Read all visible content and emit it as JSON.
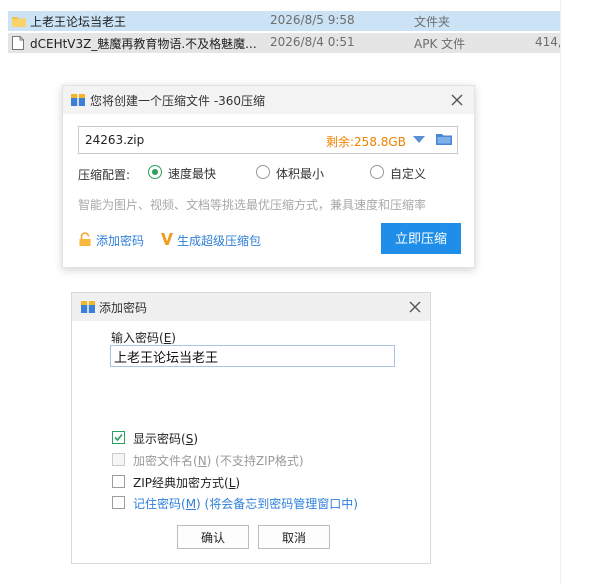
{
  "explorer": {
    "files": [
      {
        "name": "上老王论坛当老王",
        "date": "2026/8/5 9:58",
        "type": "文件夹",
        "size": "",
        "icon": "folder-icon"
      },
      {
        "name": "dCEHtV3Z_魅魔再教育物语.不及格魅魔...",
        "date": "2026/8/4 0:51",
        "type": "APK 文件",
        "size": "414,",
        "icon": "file-icon"
      }
    ]
  },
  "compress_dialog": {
    "title": "您将创建一个压缩文件 -360压缩",
    "filename": "24263.zip",
    "remaining": "剩余:258.8GB",
    "config_label": "压缩配置:",
    "options": [
      "速度最快",
      "体积最小",
      "自定义"
    ],
    "selected_option": "速度最快",
    "hint": "智能为图片、视频、文档等挑选最优压缩方式，兼具速度和压缩率",
    "add_password_label": "添加密码",
    "super_package_label": "生成超级压缩包",
    "compress_button": "立即压缩",
    "accent_color": "#1f8ee8",
    "remaining_color": "#f08200"
  },
  "password_dialog": {
    "title": "添加密码",
    "input_label": "输入密码(",
    "input_label_key": "E",
    "input_label_end": ")",
    "password_value": "上老王论坛当老王",
    "show_password": {
      "label": "显示密码(",
      "key": "S",
      "end": ")",
      "checked": true
    },
    "encrypt_filenames": {
      "label": "加密文件名(",
      "key": "N",
      "end": ") (不支持ZIP格式)",
      "checked": false,
      "enabled": false
    },
    "zip_classic": {
      "label": "ZIP经典加密方式(",
      "key": "L",
      "end": ")",
      "checked": false
    },
    "remember_password": {
      "label": "记住密码(",
      "key": "M",
      "end": ") (将会备忘到密码管理窗口中)",
      "checked": false
    },
    "ok_button": "确认",
    "cancel_button": "取消"
  }
}
